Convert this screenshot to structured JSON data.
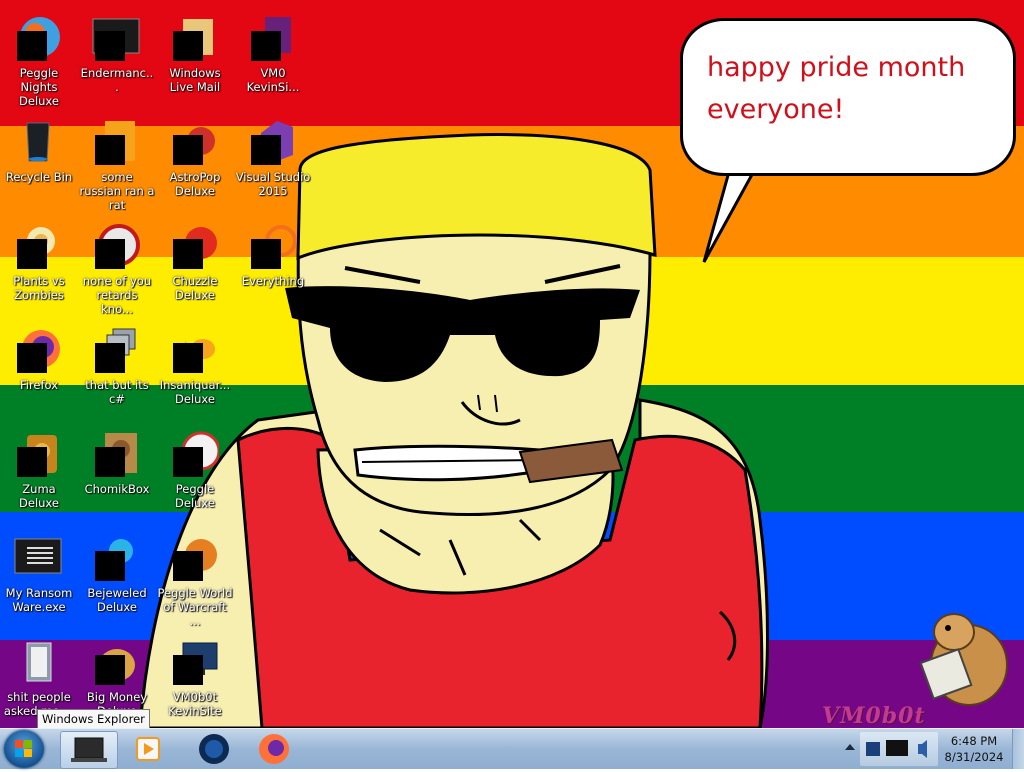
{
  "desktop": {
    "wallpaper_colors": [
      "#e30613",
      "#ff8c00",
      "#ffed00",
      "#008026",
      "#004dff",
      "#750787"
    ],
    "speech_bubble": {
      "line1": "happy pride month",
      "line2": "everyone!",
      "text_color": "#d10f1a"
    },
    "watermark": "VM0b0t",
    "icons": [
      {
        "label": "Peggle Nights Deluxe",
        "icon": "peggle-nights-icon"
      },
      {
        "label": "Endermanc...",
        "icon": "program-window-icon"
      },
      {
        "label": "Windows Live Mail",
        "icon": "folder-mail-icon"
      },
      {
        "label": "VM0 KevinSi...",
        "icon": "visual-studio-file-icon"
      },
      {
        "label": "Recycle Bin",
        "icon": "recycle-bin-icon"
      },
      {
        "label": "some russian ran a rat",
        "icon": "adobe-icon"
      },
      {
        "label": "AstroPop Deluxe",
        "icon": "astropop-icon"
      },
      {
        "label": "Visual Studio 2015",
        "icon": "visual-studio-icon"
      },
      {
        "label": "Plants vs Zombies",
        "icon": "plants-vs-zombies-icon"
      },
      {
        "label": "none of you retards kno...",
        "icon": "circle-red-icon"
      },
      {
        "label": "Chuzzle Deluxe",
        "icon": "chuzzle-icon"
      },
      {
        "label": "Everything",
        "icon": "everything-search-icon"
      },
      {
        "label": "Firefox",
        "icon": "firefox-icon"
      },
      {
        "label": "that but its c#",
        "icon": "stacked-windows-icon"
      },
      {
        "label": "Insaniquar... Deluxe",
        "icon": "insaniquarium-fish-icon"
      },
      {
        "label": "Zuma Deluxe",
        "icon": "zuma-icon"
      },
      {
        "label": "ChomikBox",
        "icon": "chomikbox-icon"
      },
      {
        "label": "Peggle Deluxe",
        "icon": "peggle-icon"
      },
      {
        "label": "My Ransom Ware.exe",
        "icon": "console-window-icon"
      },
      {
        "label": "Bejeweled Deluxe",
        "icon": "bejeweled-icon"
      },
      {
        "label": "Peggle World of Warcraft ...",
        "icon": "peggle-wow-icon"
      },
      {
        "label": "shit people asked me ...",
        "icon": "folder-icon"
      },
      {
        "label": "Big Money Deluxe",
        "icon": "big-money-icon"
      },
      {
        "label": "VM0b0t KevinSite",
        "icon": "monitor-icon"
      }
    ]
  },
  "tooltip": {
    "text": "Windows Explorer"
  },
  "taskbar": {
    "start_icon": "windows-start-orb-icon",
    "pinned": [
      {
        "name": "windows-explorer-icon"
      },
      {
        "name": "windows-media-player-icon"
      },
      {
        "name": "vm-globe-icon"
      },
      {
        "name": "firefox-icon"
      }
    ],
    "clock_time": "6:48 PM",
    "clock_date": "8/31/2024"
  }
}
